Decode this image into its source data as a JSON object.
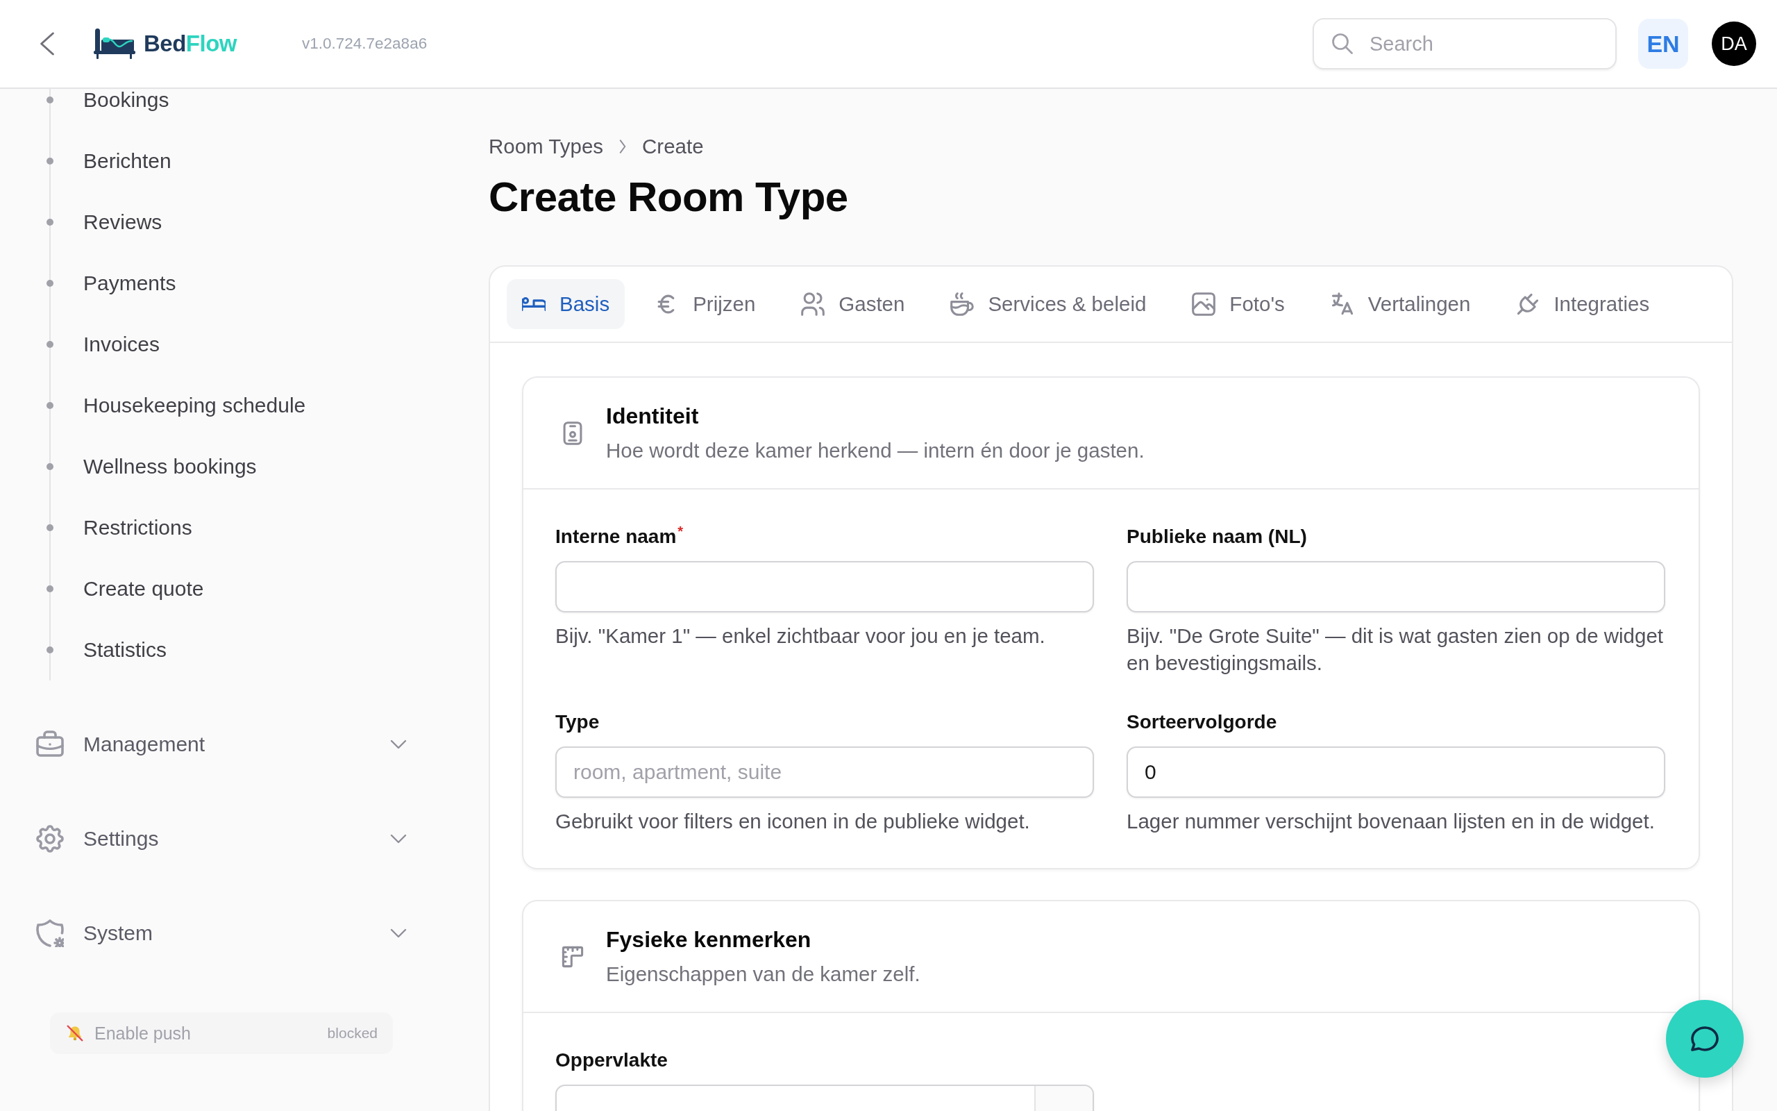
{
  "header": {
    "brand": {
      "parts": [
        "Bed",
        "Flow"
      ]
    },
    "version": "v1.0.724.7e2a8a6",
    "search": {
      "placeholder": "Search"
    },
    "language": "EN",
    "avatar": "DA"
  },
  "sidebar": {
    "items": [
      {
        "label": "Bookings",
        "selected": false
      },
      {
        "label": "Berichten",
        "selected": false
      },
      {
        "label": "Reviews",
        "selected": false
      },
      {
        "label": "Payments",
        "selected": false
      },
      {
        "label": "Invoices",
        "selected": false
      },
      {
        "label": "Housekeeping schedule",
        "selected": false
      },
      {
        "label": "Wellness bookings",
        "selected": false
      },
      {
        "label": "Restrictions",
        "selected": false
      },
      {
        "label": "Create quote",
        "selected": false
      },
      {
        "label": "Statistics",
        "selected": false
      }
    ],
    "groups": [
      {
        "label": "Management",
        "expanded": false
      },
      {
        "label": "Settings",
        "expanded": false
      },
      {
        "label": "System",
        "expanded": false
      }
    ],
    "push": {
      "label": "Enable push",
      "status": "blocked",
      "disabled": true
    }
  },
  "breadcrumb": [
    "Room Types",
    "Create"
  ],
  "title": "Create Room Type",
  "tabs": [
    {
      "label": "Basis",
      "selected": true
    },
    {
      "label": "Prijzen",
      "selected": false
    },
    {
      "label": "Gasten",
      "selected": false
    },
    {
      "label": "Services & beleid",
      "selected": false
    },
    {
      "label": "Foto's",
      "selected": false
    },
    {
      "label": "Vertalingen",
      "selected": false
    },
    {
      "label": "Integraties",
      "selected": false
    }
  ],
  "sections": [
    {
      "title": "Identiteit",
      "subtitle": "Hoe wordt deze kamer herkend — intern én door je gasten.",
      "fields": [
        {
          "kind": "text",
          "label": "Interne naam",
          "required_mark": "*",
          "hint": "Bijv. \"Kamer 1\" — enkel zichtbaar voor jou en je team."
        },
        {
          "kind": "text",
          "label": "Publieke naam (NL)",
          "hint": "Bijv. \"De Grote Suite\" — dit is wat gasten zien op de widget en bevestigingsmails."
        },
        {
          "kind": "text",
          "label": "Type",
          "placeholder": "room, apartment, suite",
          "hint": "Gebruikt voor filters en iconen in de publieke widget."
        },
        {
          "kind": "text",
          "label": "Sorteervolgorde",
          "value": "0",
          "hint": "Lager nummer verschijnt bovenaan lijsten en in de widget."
        }
      ]
    },
    {
      "title": "Fysieke kenmerken",
      "subtitle": "Eigenschappen van de kamer zelf.",
      "fields": [
        {
          "kind": "unit",
          "label": "Oppervlakte"
        }
      ]
    }
  ]
}
